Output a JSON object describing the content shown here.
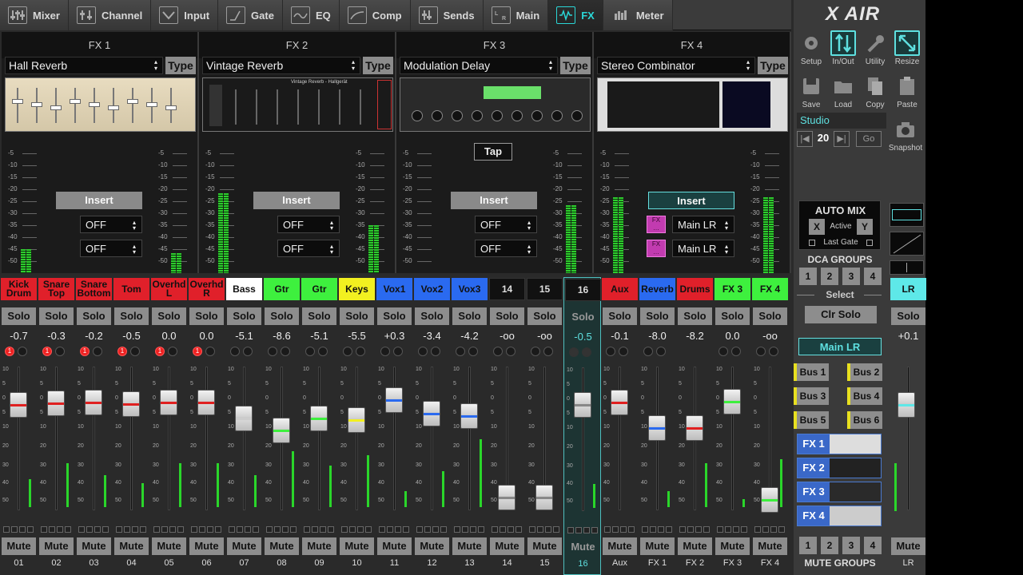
{
  "tabs": [
    {
      "label": "Mixer",
      "icon": "mixer-icon"
    },
    {
      "label": "Channel",
      "icon": "channel-icon"
    },
    {
      "label": "Input",
      "icon": "input-icon"
    },
    {
      "label": "Gate",
      "icon": "gate-icon"
    },
    {
      "label": "EQ",
      "icon": "eq-icon"
    },
    {
      "label": "Comp",
      "icon": "comp-icon"
    },
    {
      "label": "Sends",
      "icon": "sends-icon"
    },
    {
      "label": "Main",
      "icon": "main-icon"
    },
    {
      "label": "FX",
      "icon": "fx-wave-icon",
      "active": true
    },
    {
      "label": "Meter",
      "icon": "meter-icon"
    }
  ],
  "fx": [
    {
      "title": "FX 1",
      "preset": "Hall Reverb",
      "type": "Type",
      "insert": "Insert",
      "sel1": "OFF",
      "sel2": "OFF"
    },
    {
      "title": "FX 2",
      "preset": "Vintage Reverb",
      "type": "Type",
      "insert": "Insert",
      "sel1": "OFF",
      "sel2": "OFF",
      "thumb_title": "Vintage Reverb - Hallgerät"
    },
    {
      "title": "FX 3",
      "preset": "Modulation Delay",
      "type": "Type",
      "insert": "Insert",
      "sel1": "OFF",
      "sel2": "OFF",
      "tap": "Tap"
    },
    {
      "title": "FX 4",
      "preset": "Stereo Combinator",
      "type": "Type",
      "insert": "Insert",
      "sel1": "Main LR",
      "sel2": "Main LR"
    }
  ],
  "meter_scale": [
    "-5",
    "-10",
    "-15",
    "-20",
    "-25",
    "-30",
    "-35",
    "-40",
    "-45",
    "-50"
  ],
  "fader_scale": [
    "10",
    "5",
    "0",
    "5",
    "10",
    "20",
    "30",
    "40",
    "50"
  ],
  "strip_buttons": {
    "solo": "Solo",
    "mute": "Mute"
  },
  "channels": [
    {
      "label": "Kick Drum",
      "bg": "#e0202a",
      "fg": "#111",
      "gain": "-0.7",
      "num": "01",
      "red": true,
      "color": "#e02020"
    },
    {
      "label": "Snare Top",
      "bg": "#e0202a",
      "fg": "#111",
      "gain": "-0.3",
      "num": "02",
      "red": true,
      "color": "#e02020"
    },
    {
      "label": "Snare Bottom",
      "bg": "#e0202a",
      "fg": "#111",
      "gain": "-0.2",
      "num": "03",
      "red": true,
      "color": "#e02020"
    },
    {
      "label": "Tom",
      "bg": "#e0202a",
      "fg": "#111",
      "gain": "-0.5",
      "num": "04",
      "red": true,
      "color": "#e02020"
    },
    {
      "label": "Overhd L",
      "bg": "#e0202a",
      "fg": "#111",
      "gain": "0.0",
      "num": "05",
      "red": true,
      "color": "#e02020"
    },
    {
      "label": "Overhd R",
      "bg": "#e0202a",
      "fg": "#111",
      "gain": "0.0",
      "num": "06",
      "red": true,
      "color": "#e02020"
    },
    {
      "label": "Bass",
      "bg": "#ffffff",
      "fg": "#111",
      "gain": "-5.1",
      "num": "07",
      "red": false,
      "color": "#cccccc"
    },
    {
      "label": "Gtr",
      "bg": "#3ef03e",
      "fg": "#111",
      "gain": "-8.6",
      "num": "08",
      "red": false,
      "color": "#3ef03e"
    },
    {
      "label": "Gtr",
      "bg": "#3ef03e",
      "fg": "#111",
      "gain": "-5.1",
      "num": "09",
      "red": false,
      "color": "#3ef03e"
    },
    {
      "label": "Keys",
      "bg": "#f2f020",
      "fg": "#111",
      "gain": "-5.5",
      "num": "10",
      "red": false,
      "color": "#f2f020"
    },
    {
      "label": "Vox1",
      "bg": "#2a6af0",
      "fg": "#111",
      "gain": "+0.3",
      "num": "11",
      "red": false,
      "color": "#2a6af0"
    },
    {
      "label": "Vox2",
      "bg": "#2a6af0",
      "fg": "#111",
      "gain": "-3.4",
      "num": "12",
      "red": false,
      "color": "#2a6af0"
    },
    {
      "label": "Vox3",
      "bg": "#2a6af0",
      "fg": "#111",
      "gain": "-4.2",
      "num": "13",
      "red": false,
      "color": "#2a6af0"
    },
    {
      "label": "14",
      "bg": "#111111",
      "fg": "#ddd",
      "gain": "-oo",
      "num": "14",
      "red": false,
      "color": "#888"
    },
    {
      "label": "15",
      "bg": "#111111",
      "fg": "#ddd",
      "gain": "-oo",
      "num": "15",
      "red": false,
      "color": "#888"
    },
    {
      "label": "16",
      "bg": "#111111",
      "fg": "#ddd",
      "gain": "-0.5",
      "num": "16",
      "red": false,
      "color": "#888",
      "selected": true
    },
    {
      "label": "Aux",
      "bg": "#e0202a",
      "fg": "#111",
      "gain": "-0.1",
      "num": "Aux",
      "red": false,
      "color": "#e02020"
    },
    {
      "label": "Reverb",
      "bg": "#2a6af0",
      "fg": "#111",
      "gain": "-8.0",
      "num": "FX 1",
      "red": false,
      "color": "#2a6af0"
    },
    {
      "label": "Drums",
      "bg": "#e0202a",
      "fg": "#111",
      "gain": "-8.2",
      "num": "FX 2",
      "red": false,
      "color": "#e02020"
    },
    {
      "label": "FX 3",
      "bg": "#3ef03e",
      "fg": "#111",
      "gain": "0.0",
      "num": "FX 3",
      "red": false,
      "color": "#3ef03e"
    },
    {
      "label": "FX 4",
      "bg": "#3ef03e",
      "fg": "#111",
      "gain": "-oo",
      "num": "FX 4",
      "red": false,
      "color": "#3ef03e"
    }
  ],
  "lr": {
    "label": "LR",
    "gain": "+0.1",
    "num": "LR",
    "solo": "Solo",
    "mute": "Mute"
  },
  "side": {
    "logo": "X AIR",
    "tools": [
      {
        "label": "Setup",
        "icon": "gear-icon"
      },
      {
        "label": "In/Out",
        "icon": "in-out-icon",
        "hl": true
      },
      {
        "label": "Utility",
        "icon": "wrench-icon"
      },
      {
        "label": "Resize",
        "icon": "resize-icon",
        "hl": true
      },
      {
        "label": "Save",
        "icon": "save-icon"
      },
      {
        "label": "Load",
        "icon": "folder-icon"
      },
      {
        "label": "Copy",
        "icon": "copy-icon"
      },
      {
        "label": "Paste",
        "icon": "paste-icon"
      }
    ],
    "scene": "Studio",
    "scene_num": "20",
    "go": "Go",
    "snapshot": "Snapshot",
    "automix_title": "AUTO MIX",
    "automix_x": "X",
    "automix_active": "Active",
    "automix_y": "Y",
    "automix_lastgate": "Last Gate",
    "dca_title": "DCA GROUPS",
    "dca": [
      "1",
      "2",
      "3",
      "4"
    ],
    "select": "Select",
    "clr_solo": "Clr Solo",
    "main_lr": "Main LR",
    "buses": [
      "Bus 1",
      "Bus 2",
      "Bus 3",
      "Bus 4",
      "Bus 5",
      "Bus 6"
    ],
    "fxsends": [
      "FX 1",
      "FX 2",
      "FX 3",
      "FX 4"
    ],
    "mute_groups": [
      "1",
      "2",
      "3",
      "4"
    ],
    "mute_title": "MUTE GROUPS"
  }
}
